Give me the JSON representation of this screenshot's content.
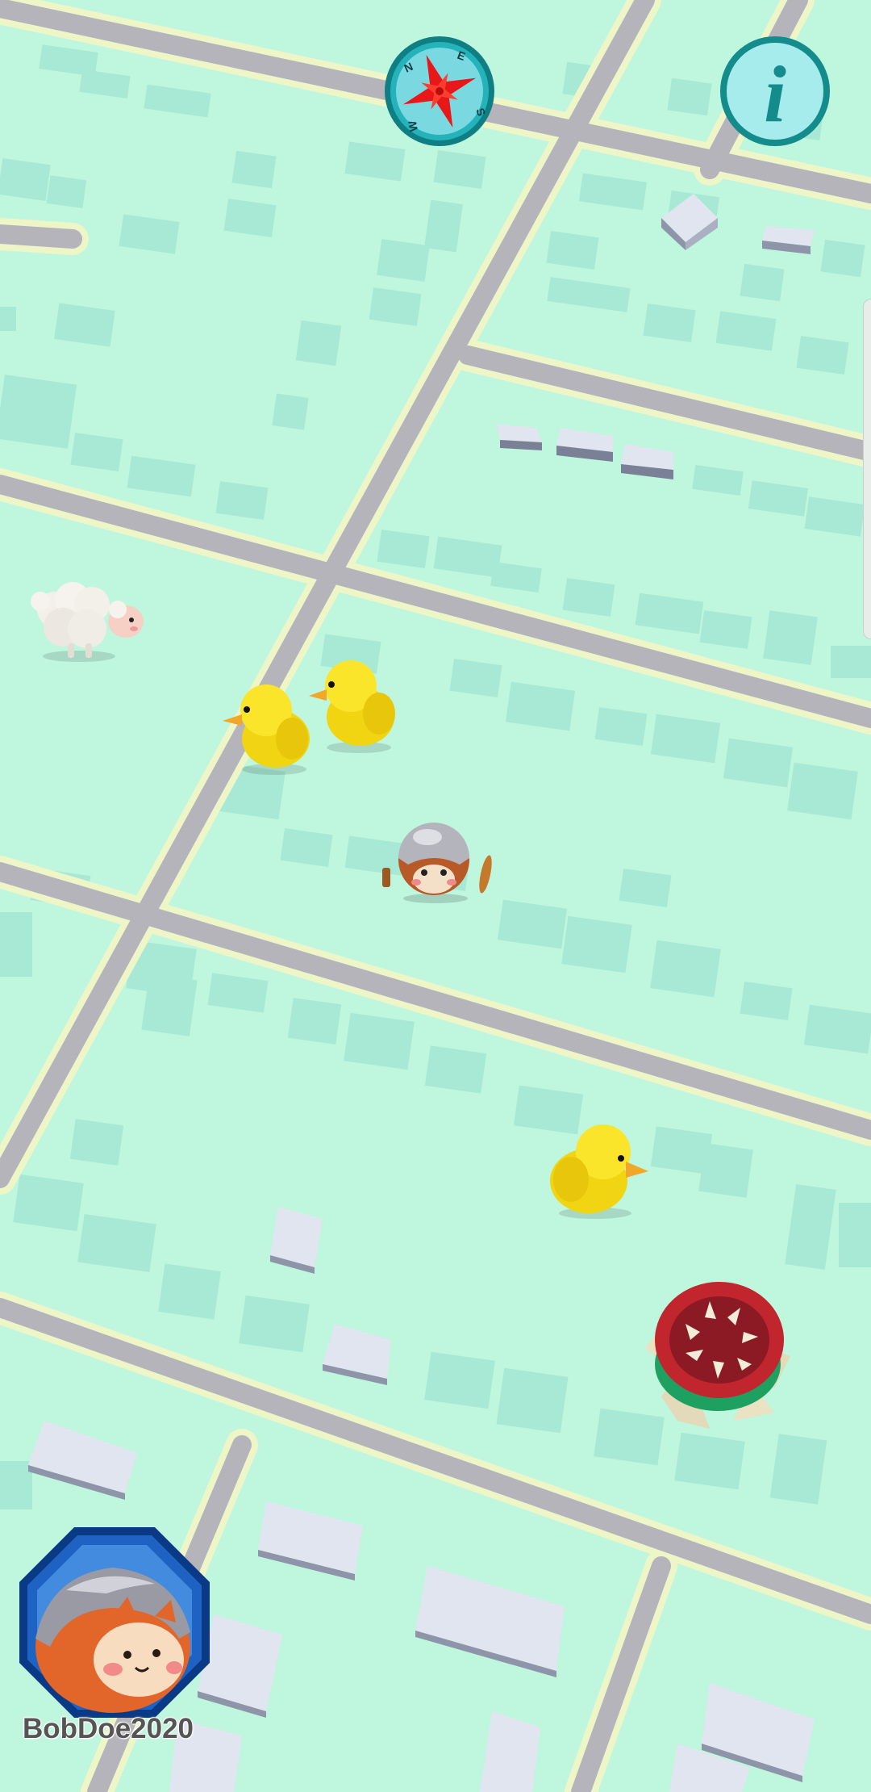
{
  "player": {
    "username": "BobDoe2020"
  },
  "compass": {
    "north": "N",
    "east": "E",
    "south": "S",
    "west": "W"
  },
  "info_button": {
    "glyph": "i"
  },
  "colors": {
    "land": "#bff6de",
    "road": "#b6b4bb",
    "road_glow": "#f2f6c4",
    "building": "#a9e8d6",
    "building_3d": "#e0e4ee",
    "hud_teal": "#148c8c",
    "hud_cyan": "#a6ecec",
    "compass_star": "#e81818"
  },
  "map_creatures": [
    {
      "kind": "sheep",
      "icon": "sheep-icon"
    },
    {
      "kind": "duck",
      "icon": "duck-icon"
    },
    {
      "kind": "duck",
      "icon": "duck-icon"
    },
    {
      "kind": "player",
      "icon": "player-character-icon"
    },
    {
      "kind": "duck",
      "icon": "duck-icon"
    },
    {
      "kind": "carnivorous-plant",
      "icon": "plant-monster-icon"
    }
  ]
}
